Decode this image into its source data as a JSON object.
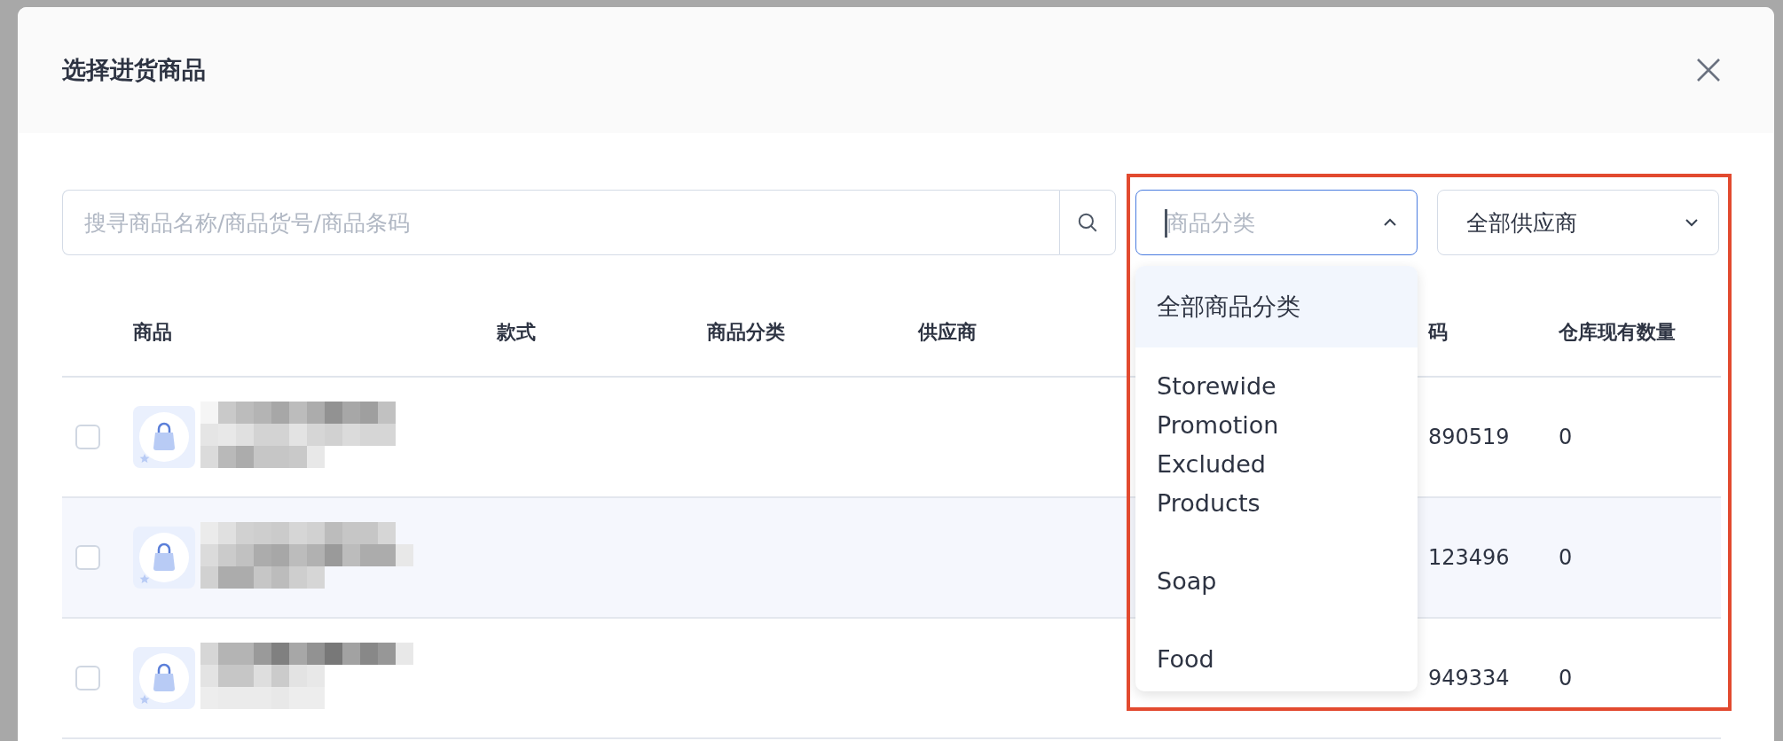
{
  "dialog": {
    "title": "选择进货商品"
  },
  "search": {
    "placeholder": "搜寻商品名称/商品货号/商品条码"
  },
  "category_select": {
    "placeholder": "商品分类",
    "expanded": true,
    "options": [
      {
        "label": "全部商品分类",
        "highlighted": true
      },
      {
        "label": "Storewide Promotion Excluded Products",
        "highlighted": false
      },
      {
        "label": "Soap",
        "highlighted": false
      },
      {
        "label": "Food",
        "highlighted": false
      }
    ]
  },
  "supplier_select": {
    "value": "全部供应商",
    "expanded": false
  },
  "table": {
    "columns": [
      "商品",
      "款式",
      "商品分类",
      "供应商",
      "码",
      "仓库现有数量"
    ],
    "rows": [
      {
        "checked": false,
        "hovered": false,
        "barcode": "890519",
        "stock": "0"
      },
      {
        "checked": false,
        "hovered": true,
        "barcode": "123496",
        "stock": "0"
      },
      {
        "checked": false,
        "hovered": false,
        "barcode": "949334",
        "stock": "0"
      }
    ]
  },
  "highlight_box": true
}
